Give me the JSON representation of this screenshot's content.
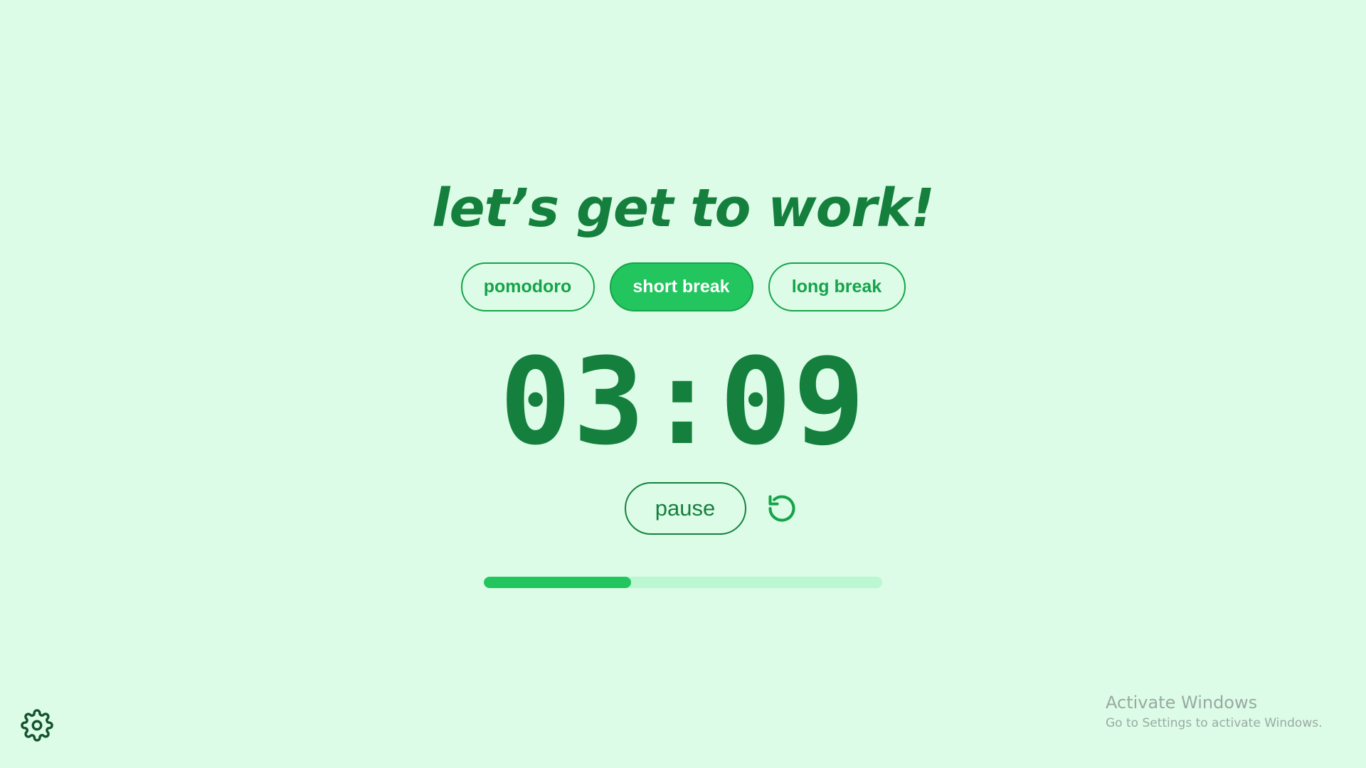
{
  "headline": "let’s get to work!",
  "modes": [
    {
      "label": "pomodoro",
      "active": false
    },
    {
      "label": "short break",
      "active": true
    },
    {
      "label": "long break",
      "active": false
    }
  ],
  "timer": {
    "display": "03:09"
  },
  "controls": {
    "pause_label": "pause",
    "reset_icon": "reset-icon"
  },
  "progress": {
    "fraction": 0.37
  },
  "settings": {
    "icon": "gear-icon"
  },
  "watermark": {
    "title": "Activate Windows",
    "subtitle": "Go to Settings to activate Windows."
  },
  "colors": {
    "background": "#dcfce7",
    "primary": "#15803d",
    "accent": "#22c55e",
    "track": "#bbf7d0"
  }
}
